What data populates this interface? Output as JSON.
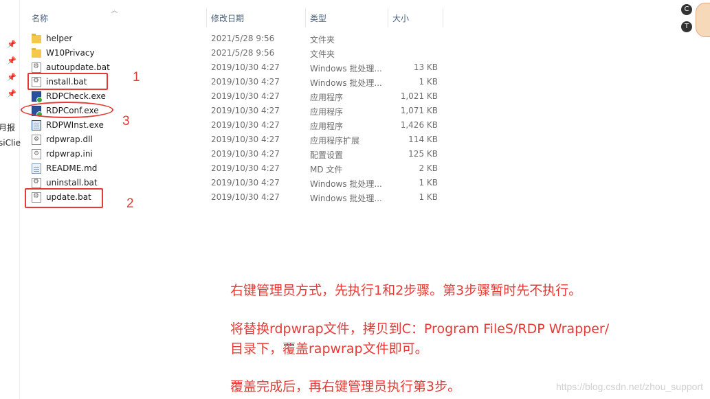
{
  "header": {
    "name": "名称",
    "date": "修改日期",
    "type": "类型",
    "size": "大小"
  },
  "left_nav": {
    "clipped": [
      "月报",
      "siClie"
    ]
  },
  "files": [
    {
      "icon": "folder-icon",
      "name": "helper",
      "date": "2021/5/28 9:56",
      "type": "文件夹",
      "size": ""
    },
    {
      "icon": "folder-icon",
      "name": "W10Privacy",
      "date": "2021/5/28 9:56",
      "type": "文件夹",
      "size": ""
    },
    {
      "icon": "batch-file-icon",
      "name": "autoupdate.bat",
      "date": "2019/10/30 4:27",
      "type": "Windows 批处理...",
      "size": "13 KB"
    },
    {
      "icon": "batch-file-icon",
      "name": "install.bat",
      "date": "2019/10/30 4:27",
      "type": "Windows 批处理...",
      "size": "1 KB"
    },
    {
      "icon": "application-icon",
      "name": "RDPCheck.exe",
      "date": "2019/10/30 4:27",
      "type": "应用程序",
      "size": "1,021 KB"
    },
    {
      "icon": "application-icon",
      "name": "RDPConf.exe",
      "date": "2019/10/30 4:27",
      "type": "应用程序",
      "size": "1,071 KB"
    },
    {
      "icon": "installer-icon",
      "name": "RDPWInst.exe",
      "date": "2019/10/30 4:27",
      "type": "应用程序",
      "size": "1,426 KB"
    },
    {
      "icon": "dll-file-icon",
      "name": "rdpwrap.dll",
      "date": "2019/10/30 4:27",
      "type": "应用程序扩展",
      "size": "114 KB"
    },
    {
      "icon": "config-file-icon",
      "name": "rdpwrap.ini",
      "date": "2019/10/30 4:27",
      "type": "配置设置",
      "size": "125 KB"
    },
    {
      "icon": "markdown-file-icon",
      "name": "README.md",
      "date": "2019/10/30 4:27",
      "type": "MD 文件",
      "size": "2 KB"
    },
    {
      "icon": "batch-file-icon",
      "name": "uninstall.bat",
      "date": "2019/10/30 4:27",
      "type": "Windows 批处理...",
      "size": "1 KB"
    },
    {
      "icon": "batch-file-icon",
      "name": "update.bat",
      "date": "2019/10/30 4:27",
      "type": "Windows 批处理...",
      "size": "1 KB"
    }
  ],
  "annotations": {
    "step1": "1",
    "step2": "2",
    "step3": "3",
    "notes": [
      "右键管理员方式，先执行1和2步骤。第3步骤暂时先不执行。",
      "将替换rdpwrap文件，拷贝到C：Program FileS/RDP Wrapper/",
      "目录下，覆盖rapwrap文件即可。",
      "覆盖完成后，再右键管理员执行第3步。"
    ],
    "color": "#e53935"
  },
  "watermark": "https://blog.csdn.net/zhou_support",
  "deco": {
    "c_label": "C",
    "shirt_label": "T"
  }
}
